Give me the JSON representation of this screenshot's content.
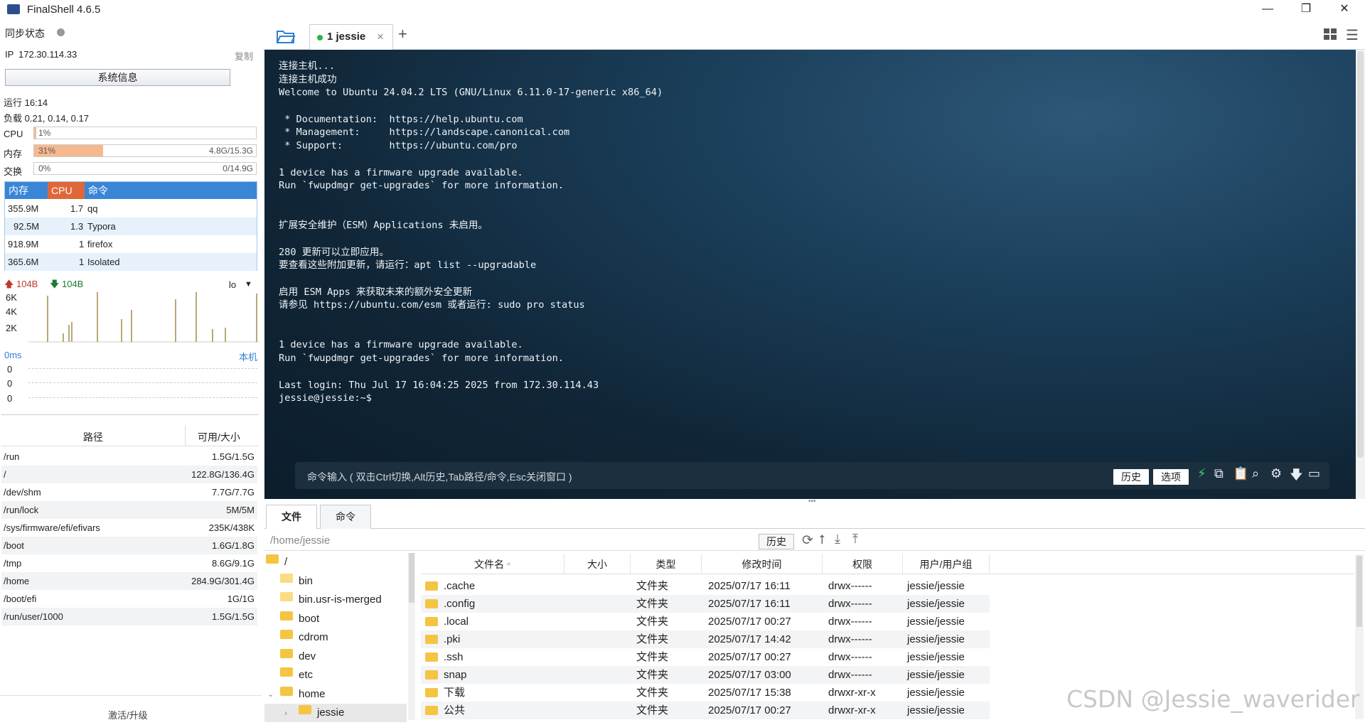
{
  "app": {
    "title": "FinalShell 4.6.5"
  },
  "window_controls": {
    "minimize": "—",
    "maximize": "❐",
    "close": "✕"
  },
  "left": {
    "sync_label": "同步状态",
    "ip_label": "IP",
    "ip": "172.30.114.33",
    "copy": "复制",
    "sysinfo_button": "系统信息",
    "uptime": "运行 16:14",
    "load": "负载 0.21, 0.14, 0.17",
    "cpu_label": "CPU",
    "cpu_pct": "1%",
    "cpu_fraction": 0.01,
    "mem_label": "内存",
    "mem_pct": "31%",
    "mem_fraction": 0.31,
    "mem_detail": "4.8G/15.3G",
    "swap_label": "交换",
    "swap_pct": "0%",
    "swap_detail": "0/14.9G",
    "proc_headers": [
      "内存",
      "CPU",
      "命令"
    ],
    "processes": [
      {
        "mem": "355.9M",
        "cpu": "1.7",
        "cmd": "qq"
      },
      {
        "mem": "92.5M",
        "cpu": "1.3",
        "cmd": "Typora"
      },
      {
        "mem": "918.9M",
        "cpu": "1",
        "cmd": "firefox"
      },
      {
        "mem": "365.6M",
        "cpu": "1",
        "cmd": "Isolated"
      }
    ],
    "net_up": "104B",
    "net_down": "104B",
    "net_iface": "lo",
    "net_yticks": [
      "6K",
      "4K",
      "2K"
    ],
    "latency": "0ms",
    "latency_host": "本机",
    "latency_vals": [
      "0",
      "0",
      "0"
    ],
    "disk_headers": [
      "路径",
      "可用/大小"
    ],
    "disks": [
      {
        "path": "/run",
        "size": "1.5G/1.5G"
      },
      {
        "path": "/",
        "size": "122.8G/136.4G"
      },
      {
        "path": "/dev/shm",
        "size": "7.7G/7.7G"
      },
      {
        "path": "/run/lock",
        "size": "5M/5M"
      },
      {
        "path": "/sys/firmware/efi/efivars",
        "size": "235K/438K"
      },
      {
        "path": "/boot",
        "size": "1.6G/1.8G"
      },
      {
        "path": "/tmp",
        "size": "8.6G/9.1G"
      },
      {
        "path": "/home",
        "size": "284.9G/301.4G"
      },
      {
        "path": "/boot/efi",
        "size": "1G/1G"
      },
      {
        "path": "/run/user/1000",
        "size": "1.5G/1.5G"
      }
    ],
    "activate": "激活/升级"
  },
  "tabs": {
    "session": "1 jessie",
    "close": "×",
    "add": "+"
  },
  "terminal": {
    "lines": [
      "连接主机...",
      "连接主机成功",
      "Welcome to Ubuntu 24.04.2 LTS (GNU/Linux 6.11.0-17-generic x86_64)",
      "",
      " * Documentation:  https://help.ubuntu.com",
      " * Management:     https://landscape.canonical.com",
      " * Support:        https://ubuntu.com/pro",
      "",
      "1 device has a firmware upgrade available.",
      "Run `fwupdmgr get-upgrades` for more information.",
      "",
      "",
      "扩展安全维护（ESM）Applications 未启用。",
      "",
      "280 更新可以立即应用。",
      "要查看这些附加更新，请运行：apt list --upgradable",
      "",
      "启用 ESM Apps 来获取未来的额外安全更新",
      "请参见 https://ubuntu.com/esm 或者运行: sudo pro status",
      "",
      "",
      "1 device has a firmware upgrade available.",
      "Run `fwupdmgr get-upgrades` for more information.",
      "",
      "Last login: Thu Jul 17 16:04:25 2025 from 172.30.114.43",
      "jessie@jessie:~$"
    ],
    "cmd_placeholder": "命令输入 ( 双击Ctrl切换,Alt历史,Tab路径/命令,Esc关闭窗口 )",
    "history_btn": "历史",
    "options_btn": "选项"
  },
  "bottom": {
    "tab_files": "文件",
    "tab_commands": "命令",
    "path": "/home/jessie",
    "history_btn": "历史",
    "tree": [
      {
        "name": "/"
      },
      {
        "name": "bin"
      },
      {
        "name": "bin.usr-is-merged"
      },
      {
        "name": "boot"
      },
      {
        "name": "cdrom"
      },
      {
        "name": "dev"
      },
      {
        "name": "etc"
      },
      {
        "name": "home"
      },
      {
        "name": "jessie"
      }
    ],
    "file_headers": [
      "文件名",
      "大小",
      "类型",
      "修改时间",
      "权限",
      "用户/用户组"
    ],
    "files": [
      {
        "name": ".cache",
        "type": "文件夹",
        "mtime": "2025/07/17 16:11",
        "perm": "drwx------",
        "owner": "jessie/jessie"
      },
      {
        "name": ".config",
        "type": "文件夹",
        "mtime": "2025/07/17 16:11",
        "perm": "drwx------",
        "owner": "jessie/jessie"
      },
      {
        "name": ".local",
        "type": "文件夹",
        "mtime": "2025/07/17 00:27",
        "perm": "drwx------",
        "owner": "jessie/jessie"
      },
      {
        "name": ".pki",
        "type": "文件夹",
        "mtime": "2025/07/17 14:42",
        "perm": "drwx------",
        "owner": "jessie/jessie"
      },
      {
        "name": ".ssh",
        "type": "文件夹",
        "mtime": "2025/07/17 00:27",
        "perm": "drwx------",
        "owner": "jessie/jessie"
      },
      {
        "name": "snap",
        "type": "文件夹",
        "mtime": "2025/07/17 03:00",
        "perm": "drwx------",
        "owner": "jessie/jessie"
      },
      {
        "name": "下载",
        "type": "文件夹",
        "mtime": "2025/07/17 15:38",
        "perm": "drwxr-xr-x",
        "owner": "jessie/jessie"
      },
      {
        "name": "公共",
        "type": "文件夹",
        "mtime": "2025/07/17 00:27",
        "perm": "drwxr-xr-x",
        "owner": "jessie/jessie"
      }
    ]
  },
  "watermark": "CSDN @Jessie_waverider",
  "colors": {
    "accent": "#2f7fd1",
    "terminal_bg": "#16324a",
    "proc_mem": "#3a86d6",
    "proc_cpu": "#e0673a"
  }
}
